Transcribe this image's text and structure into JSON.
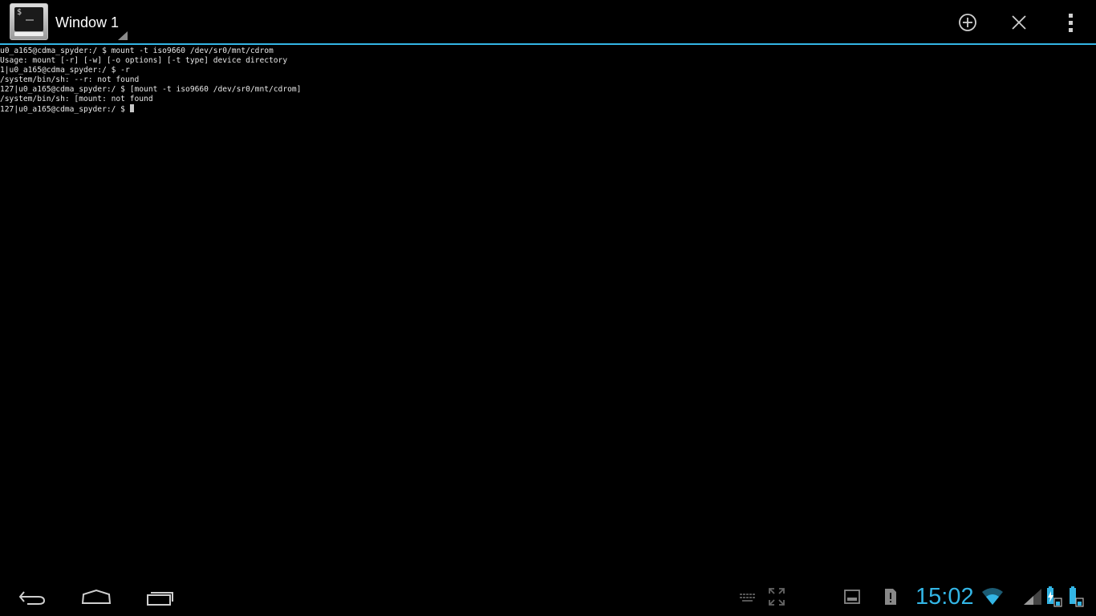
{
  "actionbar": {
    "window_title": "Window 1",
    "icons": {
      "app": "terminal-app-icon",
      "new_window": "add-circle-icon",
      "close_window": "close-icon",
      "overflow": "overflow-menu-icon"
    },
    "accent_color": "#33b5e5"
  },
  "terminal": {
    "lines": [
      "u0_a165@cdma_spyder:/ $ mount -t iso9660 /dev/sr0/mnt/cdrom",
      "Usage: mount [-r] [-w] [-o options] [-t type] device directory",
      "1|u0_a165@cdma_spyder:/ $ -r",
      "/system/bin/sh: --r: not found",
      "127|u0_a165@cdma_spyder:/ $ [mount -t iso9660 /dev/sr0/mnt/cdrom]",
      "/system/bin/sh: [mount: not found",
      "127|u0_a165@cdma_spyder:/ $ "
    ],
    "text_color": "#e8e8e8",
    "background": "#000000"
  },
  "navbar": {
    "buttons": [
      "back-icon",
      "home-icon",
      "recent-apps-icon"
    ],
    "ime_icons": [
      "keyboard-icon",
      "fullscreen-icon"
    ]
  },
  "status": {
    "notification_icons": [
      "screenshot-icon",
      "sd-card-icon"
    ],
    "clock": "15:02",
    "clock_color": "#33b5e5",
    "indicators": [
      "wifi-icon",
      "signal-icon",
      "charging-battery-icon",
      "battery-icon"
    ]
  }
}
